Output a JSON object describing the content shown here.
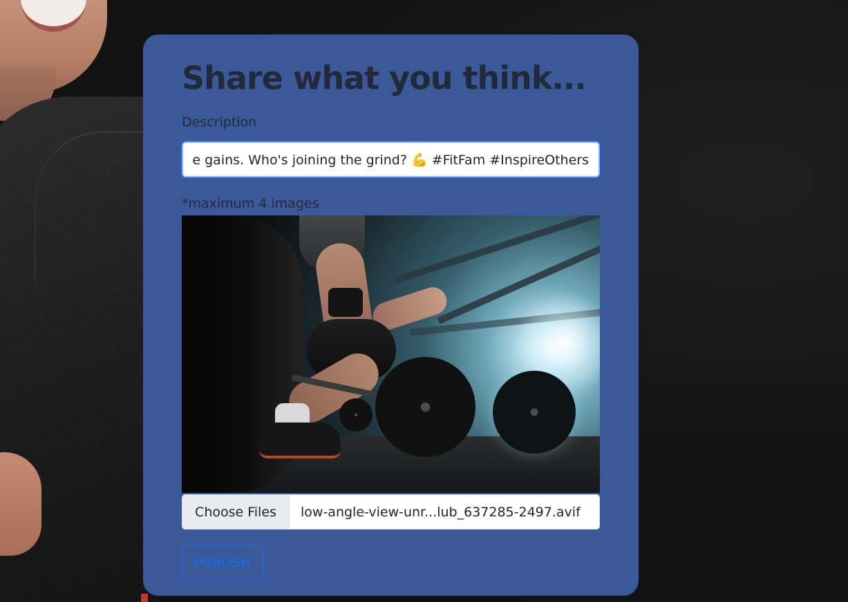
{
  "card": {
    "title": "Share what you think...",
    "description_label": "Description",
    "description_value": "Crushing my workout goals today! Consistency is key to those gains. Who's joining the grind? 💪 #FitFam #InspireOthers\"",
    "image_limit_note": "*maximum 4 images",
    "file_button_label": "Choose Files",
    "selected_file_name": "low-angle-view-unr...lub_637285-2497.avif",
    "publish_label": "PUBLISH"
  },
  "colors": {
    "page_background": "#141414",
    "card_background": "#3b5998",
    "title_text": "#222a3a",
    "publish_accent": "#0d6efd",
    "input_focus_border": "#86b7fe"
  }
}
